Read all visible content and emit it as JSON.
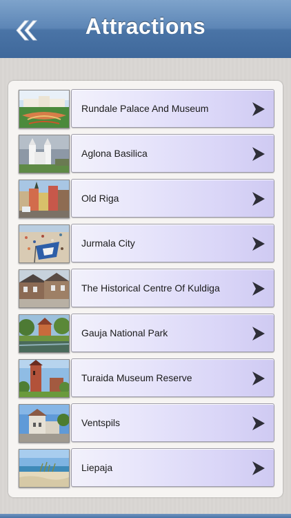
{
  "header": {
    "title": "Attractions",
    "back_icon": "double-chevron-left-icon"
  },
  "colors": {
    "header_top": "#7ea3cb",
    "header_bottom": "#3f689b",
    "button_gradient_end": "#cfcaf2"
  },
  "items": [
    {
      "label": "Rundale Palace And Museum"
    },
    {
      "label": "Aglona Basilica"
    },
    {
      "label": "Old Riga"
    },
    {
      "label": "Jurmala City"
    },
    {
      "label": "The Historical Centre Of Kuldiga"
    },
    {
      "label": "Gauja National Park"
    },
    {
      "label": "Turaida Museum Reserve"
    },
    {
      "label": "Ventspils"
    },
    {
      "label": "Liepaja"
    }
  ]
}
